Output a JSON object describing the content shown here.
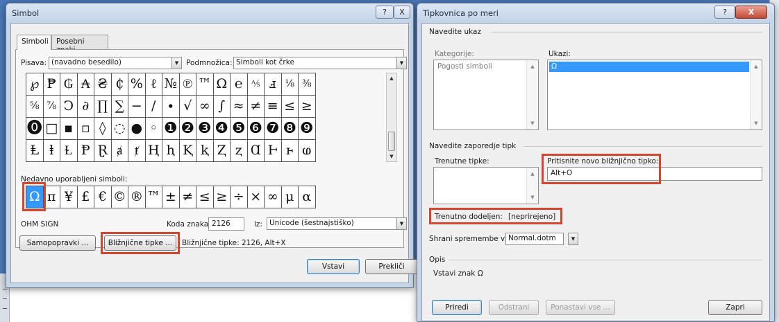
{
  "symbol_dialog": {
    "title": "Simbol",
    "title_help": "?",
    "title_close": "X",
    "tabs": [
      "Simboli",
      "Posebni znaki"
    ],
    "font_label": "Pisava:",
    "font_value": "(navadno besedilo)",
    "subset_label": "Podmnožica:",
    "subset_value": "Simboli kot črke",
    "symbols": [
      [
        "℘",
        "₱",
        "₲",
        "₳",
        "₴",
        "₵",
        "%",
        "ℓ",
        "№",
        "℗",
        "™",
        "Ω",
        "℮",
        "⅍",
        "ⅎ",
        "⅛",
        "⅜"
      ],
      [
        "⅝",
        "⅞",
        "Ↄ",
        "∂",
        "∏",
        "∑",
        "−",
        "∕",
        "∙",
        "√",
        "∞",
        "∫",
        "≈",
        "≠",
        "≡",
        "≤",
        "≥"
      ],
      [
        "⓿",
        "□",
        "▪",
        "▫",
        "◊",
        "◌",
        "●",
        "◦",
        "❶",
        "❷",
        "❸",
        "❹",
        "❺",
        "❻",
        "❼",
        "❽",
        "❾"
      ],
      [
        "Ⱡ",
        "ⱡ",
        "Ɫ",
        "Ᵽ",
        "Ɽ",
        "ⱥ",
        "ⱦ",
        "Ⱨ",
        "ⱨ",
        "Ⱪ",
        "ⱪ",
        "Ⱬ",
        "ⱬ",
        "Ɑ",
        "Ⱶ",
        "ⱶ",
        "ⱷ"
      ]
    ],
    "recent_label": "Nedavno uporabljeni simboli:",
    "recent": [
      "Ω",
      "π",
      "¥",
      "£",
      "€",
      "©",
      "®",
      "™",
      "±",
      "≠",
      "≤",
      "≥",
      "÷",
      "×",
      "∞",
      "μ",
      "α"
    ],
    "char_name": "OHM SIGN",
    "code_label": "Koda znaka:",
    "code_value": "2126",
    "from_label": "iz:",
    "from_value": "Unicode (šestnajstiško)",
    "autocorrect_button": "Samopopravki ...",
    "shortcut_button": "Bližnjične tipke ...",
    "shortcut_info": "Bližnjične tipke: 2126, Alt+X",
    "insert_button": "Vstavi",
    "cancel_button": "Prekliči"
  },
  "keyboard_dialog": {
    "title": "Tipkovnica po meri",
    "title_help": "?",
    "title_close": "X",
    "command_group": "Navedite ukaz",
    "categories_label": "Kategorije:",
    "categories_items": [
      "Pogosti simboli"
    ],
    "commands_label": "Ukazi:",
    "commands_items": [
      "Ω"
    ],
    "keys_group": "Navedite zaporedje tipk",
    "current_keys_label": "Trenutne tipke:",
    "new_key_label": "Pritisnite novo bližnjično tipko:",
    "new_key_value": "Alt+O",
    "assigned_label": "Trenutno dodeljen:",
    "assigned_value": "[neprirejeno]",
    "save_in_label": "Shrani spremembe v:",
    "save_in_value": "Normal.dotm",
    "desc_group": "Opis",
    "desc_text": "Vstavi znak Ω",
    "assign_button": "Priredi",
    "remove_button": "Odstrani",
    "reset_button": "Ponastavi vse ...",
    "close_button": "Zapri"
  },
  "colors": {
    "highlight": "#d8442c",
    "selection": "#3399ff",
    "window_frame": "#c7d5e8"
  }
}
